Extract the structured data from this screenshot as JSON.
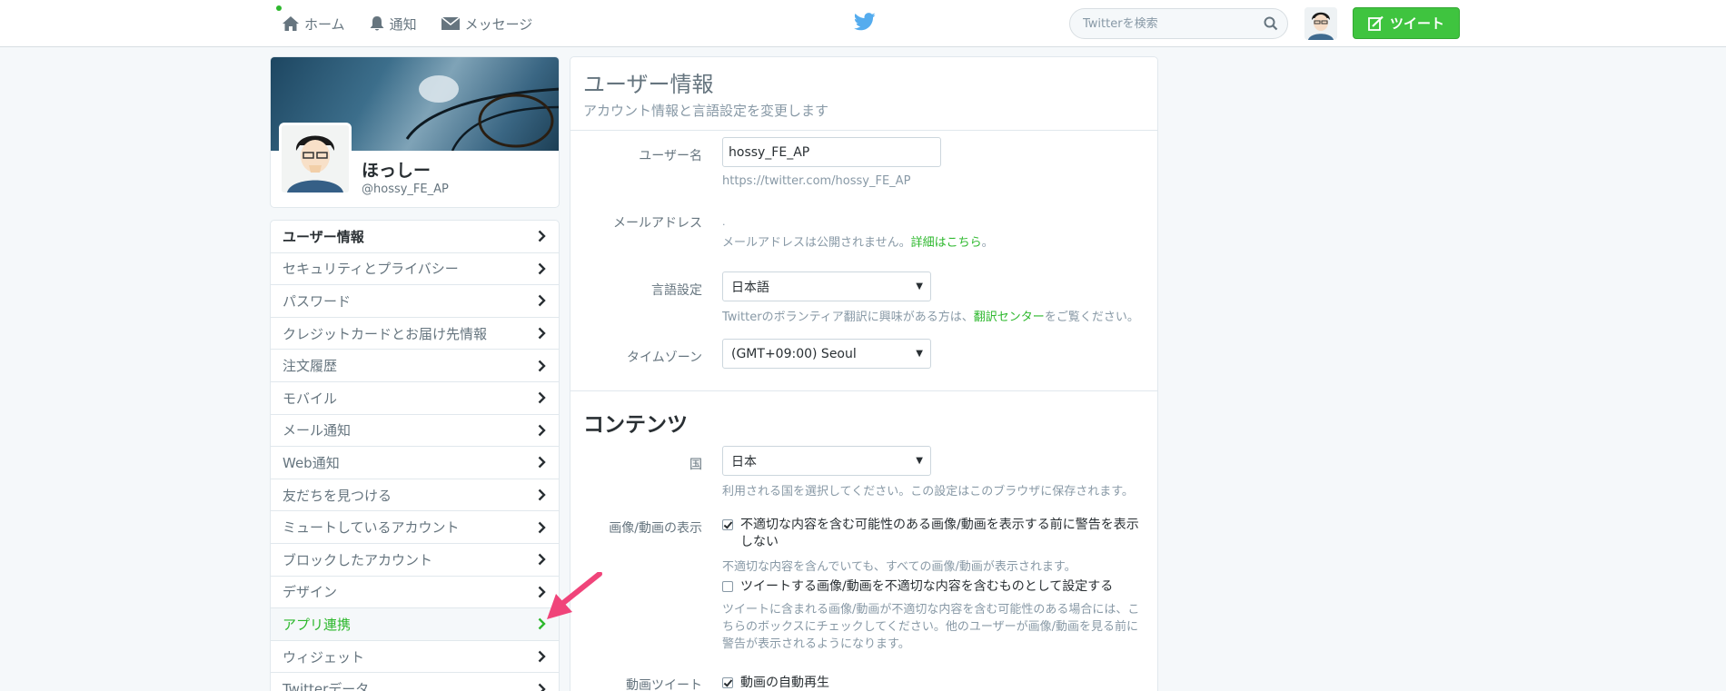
{
  "nav": {
    "home": "ホーム",
    "notifications": "通知",
    "messages": "メッセージ"
  },
  "search": {
    "placeholder": "Twitterを検索"
  },
  "tweet_button": "ツイート",
  "profile": {
    "name": "ほっしー",
    "handle": "@hossy_FE_AP"
  },
  "menu": {
    "items": [
      "ユーザー情報",
      "セキュリティとプライバシー",
      "パスワード",
      "クレジットカードとお届け先情報",
      "注文履歴",
      "モバイル",
      "メール通知",
      "Web通知",
      "友だちを見つける",
      "ミュートしているアカウント",
      "ブロックしたアカウント",
      "デザイン",
      "アプリ連携",
      "ウィジェット",
      "Twitterデータ"
    ]
  },
  "account": {
    "title": "ユーザー情報",
    "subtitle": "アカウント情報と言語設定を変更します",
    "username_label": "ユーザー名",
    "username_value": "hossy_FE_AP",
    "username_url": "https://twitter.com/hossy_FE_AP",
    "email_label": "メールアドレス",
    "email_help": "メールアドレスは公開されません。",
    "email_help_link": "詳細はこちら",
    "email_help_end": "。",
    "language_label": "言語設定",
    "language_value": "日本語",
    "language_help": "Twitterのボランティア翻訳に興味がある方は、",
    "language_help_link": "翻訳センター",
    "language_help_end": "をご覧ください。",
    "timezone_label": "タイムゾーン",
    "timezone_value": "(GMT+09:00) Seoul"
  },
  "content": {
    "title": "コンテンツ",
    "country_label": "国",
    "country_value": "日本",
    "country_help": "利用される国を選択してください。この設定はこのブラウザに保存されます。",
    "media_label": "画像/動画の表示",
    "media_warn_label": "不適切な内容を含む可能性のある画像/動画を表示する前に警告を表示しない",
    "media_warn_checked": true,
    "media_warn_help": "不適切な内容を含んでいても、すべての画像/動画が表示されます。",
    "media_mark_label": "ツイートする画像/動画を不適切な内容を含むものとして設定する",
    "media_mark_checked": false,
    "media_mark_help": "ツイートに含まれる画像/動画が不適切な内容を含む可能性のある場合には、こちらのボックスにチェックしてください。他のユーザーが画像/動画を見る前に警告が表示されるようになります。",
    "video_label": "動画ツイート",
    "video_autoplay_label": "動画の自動再生",
    "video_autoplay_checked": true
  },
  "colors": {
    "accent": "#2db82d",
    "tweet_button": "#3fc43f",
    "annotation_arrow": "#f0447a"
  }
}
